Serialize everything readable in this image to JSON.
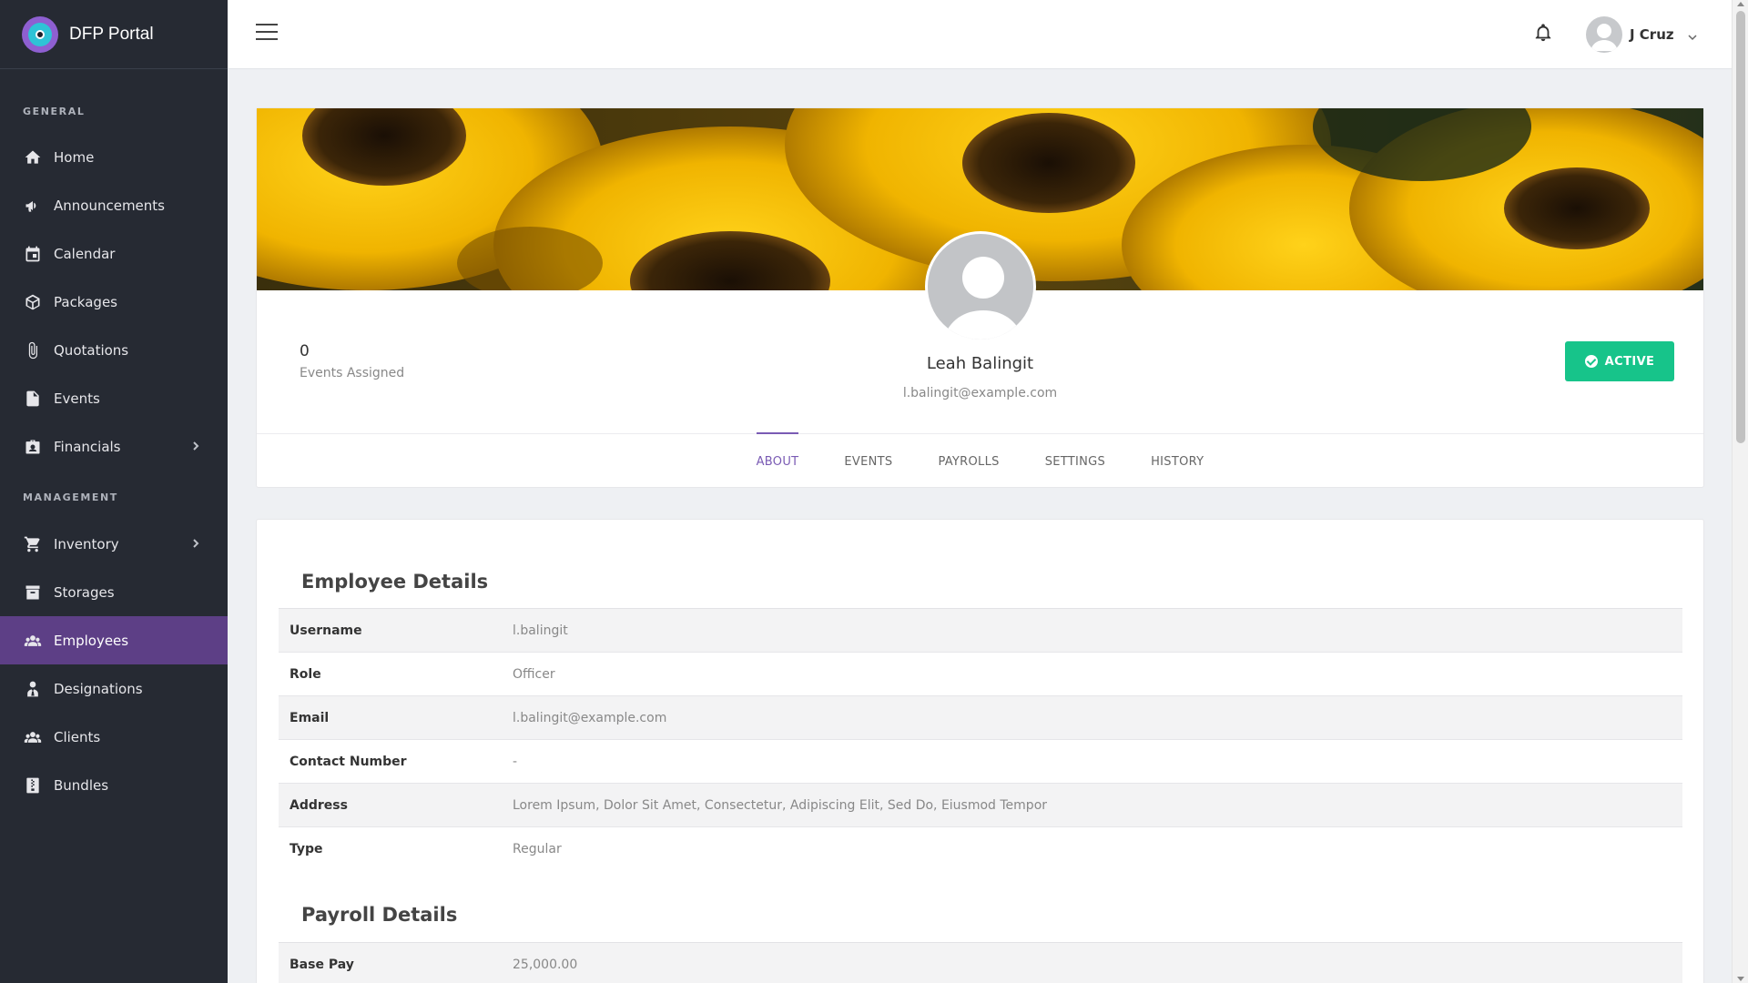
{
  "app": {
    "brand": "DFP Portal"
  },
  "sidebar": {
    "general_label": "GENERAL",
    "management_label": "MANAGEMENT",
    "general_items": [
      {
        "label": "Home",
        "icon": "home-icon"
      },
      {
        "label": "Announcements",
        "icon": "megaphone-icon"
      },
      {
        "label": "Calendar",
        "icon": "calendar-icon"
      },
      {
        "label": "Packages",
        "icon": "package-icon"
      },
      {
        "label": "Quotations",
        "icon": "paperclip-icon"
      },
      {
        "label": "Events",
        "icon": "file-icon"
      },
      {
        "label": "Financials",
        "icon": "briefcase-icon"
      }
    ],
    "management_items": [
      {
        "label": "Inventory",
        "icon": "cart-icon"
      },
      {
        "label": "Storages",
        "icon": "archive-icon"
      },
      {
        "label": "Employees",
        "icon": "users-icon",
        "active": true
      },
      {
        "label": "Designations",
        "icon": "user-tie-icon"
      },
      {
        "label": "Clients",
        "icon": "users-icon"
      },
      {
        "label": "Bundles",
        "icon": "file-zip-icon"
      }
    ]
  },
  "topbar": {
    "user_name": "J Cruz"
  },
  "profile": {
    "stat_value": "0",
    "stat_label": "Events Assigned",
    "name": "Leah Balingit",
    "email": "l.balingit@example.com",
    "status": "ACTIVE",
    "status_color": "#17c48a",
    "tabs": [
      "ABOUT",
      "EVENTS",
      "PAYROLLS",
      "SETTINGS",
      "HISTORY"
    ],
    "active_tab": "ABOUT"
  },
  "employee_details": {
    "title": "Employee Details",
    "rows": [
      {
        "key": "Username",
        "value": "l.balingit"
      },
      {
        "key": "Role",
        "value": "Officer"
      },
      {
        "key": "Email",
        "value": "l.balingit@example.com"
      },
      {
        "key": "Contact Number",
        "value": "-"
      },
      {
        "key": "Address",
        "value": "Lorem Ipsum, Dolor Sit Amet, Consectetur, Adipiscing Elit, Sed Do, Eiusmod Tempor"
      },
      {
        "key": "Type",
        "value": "Regular"
      }
    ]
  },
  "payroll_details": {
    "title": "Payroll Details",
    "rows": [
      {
        "key": "Base Pay",
        "value": "25,000.00"
      }
    ]
  },
  "colors": {
    "sidebar_bg": "#262a33",
    "active_nav": "#5d3f86",
    "accent": "#7a5bb4"
  }
}
